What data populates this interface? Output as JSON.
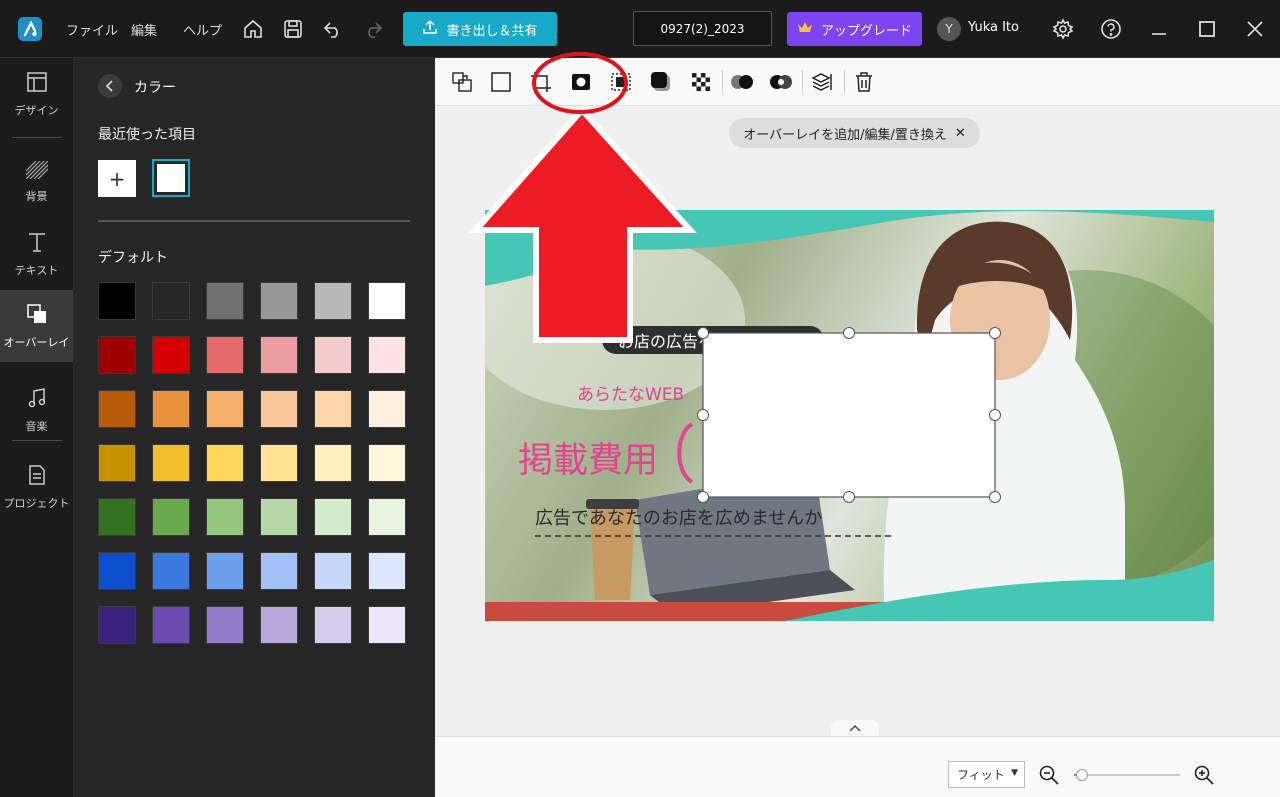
{
  "menu": {
    "file": "ファイル",
    "edit": "編集",
    "help": "ヘルプ"
  },
  "topbar": {
    "export_label": "書き出し＆共有",
    "project_name": "0927(2)_2023",
    "upgrade_label": "アップグレード",
    "avatar_initial": "Y",
    "user_name": "Yuka Ito"
  },
  "nav": {
    "design": "デザイン",
    "background": "背景",
    "text": "テキスト",
    "overlay": "オーバーレイ",
    "music": "音楽",
    "project": "プロジェクト"
  },
  "panel": {
    "title": "カラー",
    "recent_title": "最近使った項目",
    "add_symbol": "+",
    "default_title": "デフォルト"
  },
  "palette": [
    [
      "#000000",
      "#262626",
      "#717171",
      "#979797",
      "#b9b9b9",
      "#ffffff"
    ],
    [
      "#9e0000",
      "#d40000",
      "#e46a6a",
      "#ed9ea0",
      "#f5cbcd",
      "#fde3e5"
    ],
    [
      "#b75b0a",
      "#e8923c",
      "#f5b06c",
      "#f8c89a",
      "#fcd6a8",
      "#fef0dd"
    ],
    [
      "#c79300",
      "#f2c02b",
      "#ffd75a",
      "#ffe393",
      "#fff0bd",
      "#fff7dc"
    ],
    [
      "#327220",
      "#6aaa4e",
      "#95c67d",
      "#b5d9a6",
      "#d3ecc9",
      "#e8f6e1"
    ],
    [
      "#0d4fcc",
      "#3a7ae0",
      "#6e9fea",
      "#a2c1f5",
      "#c5d8fc",
      "#dde8fe"
    ],
    [
      "#39237f",
      "#6b4db2",
      "#927ec8",
      "#b7a9dc",
      "#d5cbec",
      "#ebe6f8"
    ]
  ],
  "overlay_pill": {
    "text": "オーバーレイを追加/編集/置き換え",
    "close": "✕"
  },
  "canvas": {
    "badge_text": "お店の広告を募集",
    "subtitle": "あらたなWEB",
    "headline": "掲載費用",
    "footer": "広告であなたのお店を広めませんか"
  },
  "zoom": {
    "fit_label": "フィット",
    "zoom_level": 0.08
  },
  "colors": {
    "accent": "#19a9c8",
    "upgrade": "#7d45f0",
    "teal": "#46c6b4",
    "pink": "#e0458f",
    "annotation_red": "#ec1c24"
  }
}
